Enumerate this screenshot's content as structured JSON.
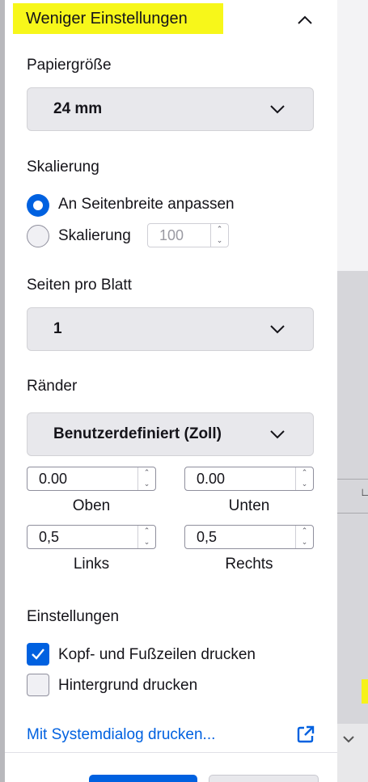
{
  "header": {
    "title": "Weniger Einstellungen"
  },
  "paper_size": {
    "label": "Papiergröße",
    "value": "24 mm"
  },
  "scaling": {
    "label": "Skalierung",
    "fit_width_label": "An Seitenbreite anpassen",
    "custom_label": "Skalierung",
    "scale_value": "100"
  },
  "pages_per_sheet": {
    "label": "Seiten pro Blatt",
    "value": "1"
  },
  "margins": {
    "label": "Ränder",
    "value": "Benutzerdefiniert (Zoll)",
    "top": {
      "value": "0.00",
      "caption": "Oben"
    },
    "bottom": {
      "value": "0.00",
      "caption": "Unten"
    },
    "left": {
      "value": "0,5",
      "caption": "Links"
    },
    "right": {
      "value": "0,5",
      "caption": "Rechts"
    }
  },
  "settings": {
    "label": "Einstellungen",
    "headers_footers_label": "Kopf- und Fußzeilen drucken",
    "headers_footers_checked": true,
    "background_label": "Hintergrund drucken",
    "background_checked": false
  },
  "system_dialog": {
    "link": "Mit Systemdialog drucken..."
  },
  "colors": {
    "accent": "#0061e0",
    "highlight": "#f7f71a"
  }
}
